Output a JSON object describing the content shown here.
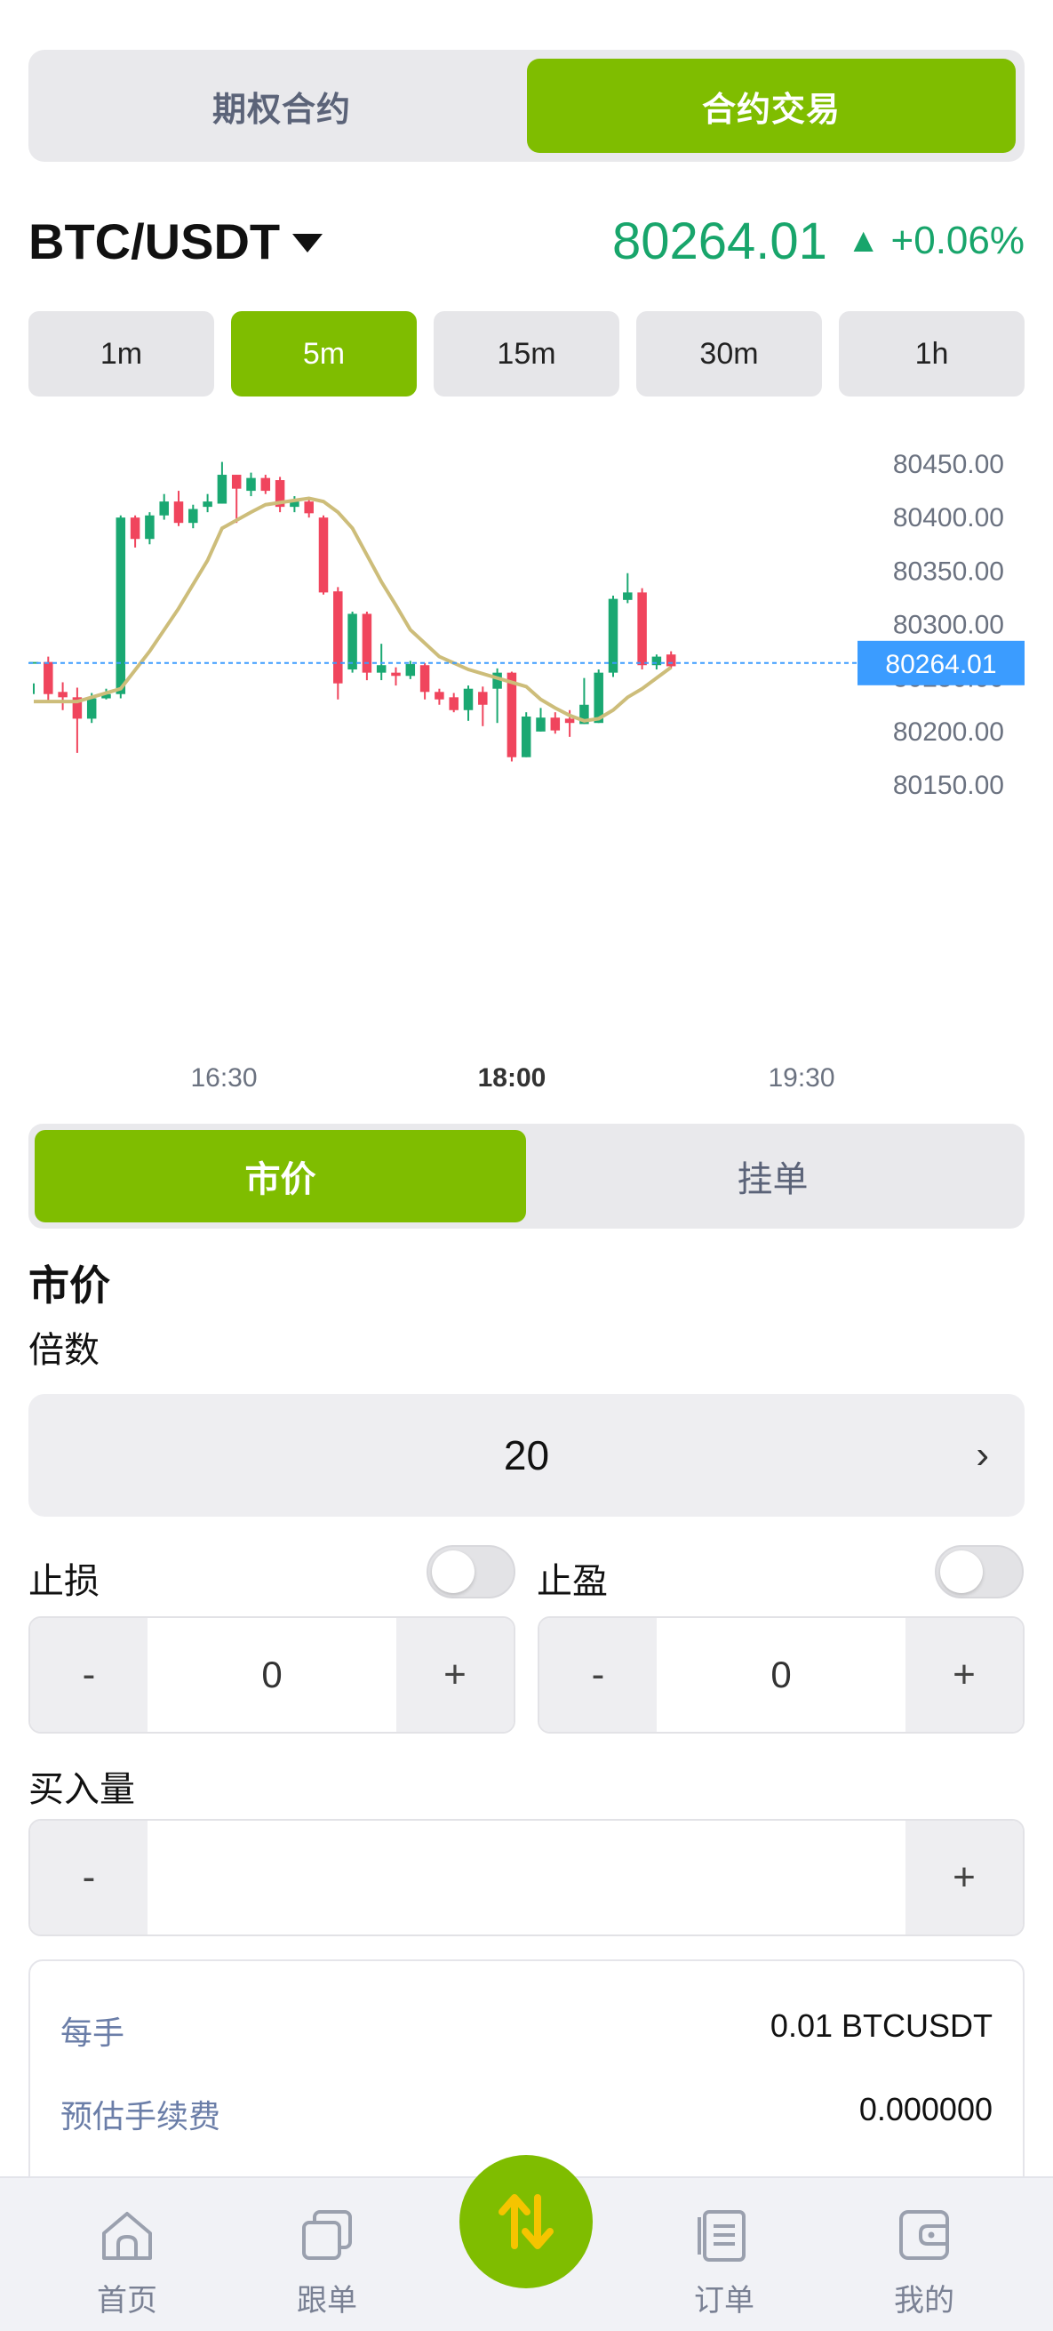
{
  "top_tabs": [
    "期权合约",
    "合约交易"
  ],
  "pair": "BTC/USDT",
  "last_price": "80264.01",
  "change_arrow": "▲",
  "change_pct": "+0.06%",
  "intervals": [
    "1m",
    "5m",
    "15m",
    "30m",
    "1h"
  ],
  "active_interval": "5m",
  "order_types": [
    "市价",
    "挂单"
  ],
  "section_title": "市价",
  "leverage_label": "倍数",
  "leverage_value": "20",
  "leverage_chevron": "›",
  "stop_loss": {
    "label": "止损",
    "value": "0",
    "minus": "-",
    "plus": "+"
  },
  "take_profit": {
    "label": "止盈",
    "value": "0",
    "minus": "-",
    "plus": "+"
  },
  "buy_qty": {
    "label": "买入量",
    "value": "",
    "minus": "-",
    "plus": "+"
  },
  "info": [
    {
      "key": "每手",
      "value": "0.01 BTCUSDT"
    },
    {
      "key": "预估手续费",
      "value": "0.000000"
    }
  ],
  "bottom_nav": [
    {
      "label": "首页",
      "icon": "home-icon"
    },
    {
      "label": "跟单",
      "icon": "copy-icon"
    },
    {
      "label": "",
      "icon": "swap-icon"
    },
    {
      "label": "订单",
      "icon": "orders-icon"
    },
    {
      "label": "我的",
      "icon": "wallet-icon"
    }
  ],
  "colors": {
    "accent": "#7fbd00",
    "up": "#1aa872",
    "down": "#f0455d",
    "ma": "#cdbd7a",
    "price_tag": "#3b9cff"
  },
  "chart_data": {
    "type": "candlestick",
    "y_ticks": [
      "80450.00",
      "80400.00",
      "80350.00",
      "80300.00",
      "80250.00",
      "80200.00",
      "80150.00"
    ],
    "ylim": [
      80132,
      80462
    ],
    "x_ticks": [
      "16:30",
      "18:00",
      "19:30"
    ],
    "current_price_label": "80264.01",
    "current_price": 80264.01,
    "candles": [
      [
        80265,
        80265,
        80245,
        80235
      ],
      [
        80265,
        80235,
        80270,
        80227
      ],
      [
        80237,
        80232,
        80246,
        80220
      ],
      [
        80232,
        80212,
        80241,
        80180
      ],
      [
        80212,
        80231,
        80236,
        80208
      ],
      [
        80231,
        80235,
        80240,
        80230
      ],
      [
        80235,
        80400,
        80402,
        80231
      ],
      [
        80400,
        80380,
        80402,
        80372
      ],
      [
        80380,
        80402,
        80405,
        80375
      ],
      [
        80402,
        80415,
        80422,
        80398
      ],
      [
        80415,
        80395,
        80425,
        80392
      ],
      [
        80395,
        80408,
        80412,
        80390
      ],
      [
        80410,
        80415,
        80422,
        80405
      ],
      [
        80413,
        80440,
        80452,
        80413
      ],
      [
        80440,
        80427,
        80440,
        80395
      ],
      [
        80425,
        80437,
        80442,
        80420
      ],
      [
        80437,
        80425,
        80440,
        80422
      ],
      [
        80435,
        80410,
        80438,
        80405
      ],
      [
        80410,
        80415,
        80420,
        80405
      ],
      [
        80415,
        80404,
        80418,
        80400
      ],
      [
        80400,
        80330,
        80402,
        80328
      ],
      [
        80331,
        80245,
        80335,
        80230
      ],
      [
        80258,
        80310,
        80312,
        80255
      ],
      [
        80310,
        80255,
        80312,
        80248
      ],
      [
        80255,
        80262,
        80282,
        80248
      ],
      [
        80255,
        80252,
        80260,
        80243
      ],
      [
        80252,
        80263,
        80266,
        80249
      ],
      [
        80262,
        80237,
        80264,
        80230
      ],
      [
        80237,
        80230,
        80240,
        80225
      ],
      [
        80232,
        80220,
        80236,
        80218
      ],
      [
        80220,
        80240,
        80243,
        80210
      ],
      [
        80237,
        80225,
        80242,
        80205
      ],
      [
        80240,
        80255,
        80259,
        80208
      ],
      [
        80255,
        80176,
        80256,
        80172
      ],
      [
        80176,
        80214,
        80218,
        80176
      ],
      [
        80200,
        80213,
        80222,
        80200
      ],
      [
        80213,
        80201,
        80218,
        80198
      ],
      [
        80212,
        80208,
        80220,
        80195
      ],
      [
        80207,
        80225,
        80250,
        80207
      ],
      [
        80208,
        80255,
        80258,
        80208
      ],
      [
        80255,
        80324,
        80327,
        80251
      ],
      [
        80323,
        80330,
        80348,
        80320
      ],
      [
        80330,
        80262,
        80334,
        80258
      ],
      [
        80262,
        80270,
        80272,
        80258
      ],
      [
        80272,
        80261,
        80275,
        80259
      ]
    ],
    "ma_points": [
      [
        0,
        80228
      ],
      [
        3,
        80228
      ],
      [
        6,
        80240
      ],
      [
        8,
        80275
      ],
      [
        10,
        80315
      ],
      [
        12,
        80360
      ],
      [
        13,
        80390
      ],
      [
        15,
        80405
      ],
      [
        16,
        80412
      ],
      [
        18,
        80416
      ],
      [
        19,
        80418
      ],
      [
        20,
        80415
      ],
      [
        21,
        80405
      ],
      [
        22,
        80390
      ],
      [
        23,
        80365
      ],
      [
        24,
        80340
      ],
      [
        25,
        80318
      ],
      [
        26,
        80295
      ],
      [
        28,
        80270
      ],
      [
        30,
        80258
      ],
      [
        32,
        80250
      ],
      [
        34,
        80242
      ],
      [
        35,
        80230
      ],
      [
        36,
        80222
      ],
      [
        37,
        80215
      ],
      [
        38,
        80210
      ],
      [
        39,
        80212
      ],
      [
        40,
        80220
      ],
      [
        41,
        80232
      ],
      [
        42,
        80240
      ],
      [
        43,
        80250
      ],
      [
        44,
        80260
      ]
    ]
  }
}
